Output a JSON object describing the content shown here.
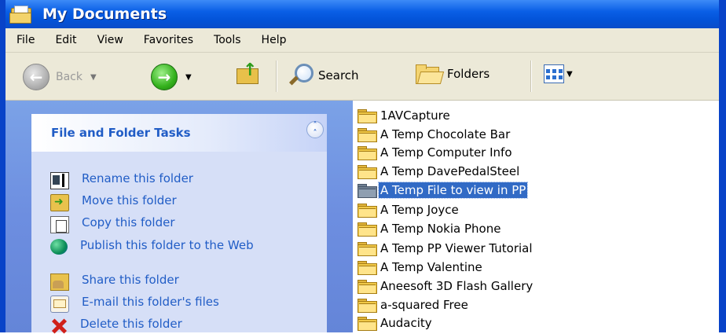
{
  "window": {
    "title": "My Documents"
  },
  "menu": [
    "File",
    "Edit",
    "View",
    "Favorites",
    "Tools",
    "Help"
  ],
  "toolbar": {
    "back_label": "Back",
    "search_label": "Search",
    "folders_label": "Folders"
  },
  "tasks": {
    "title": "File and Folder Tasks",
    "items": [
      "Rename this folder",
      "Move this folder",
      "Copy this folder",
      "Publish this folder to the Web",
      "Share this folder",
      "E-mail this folder's files",
      "Delete this folder"
    ]
  },
  "files": [
    "1AVCapture",
    "A Temp Chocolate Bar",
    "A Temp Computer Info",
    "A Temp DavePedalSteel",
    "A Temp File to view in PP",
    "A Temp Joyce",
    "A Temp Nokia Phone",
    "A Temp PP Viewer Tutorial",
    "A Temp Valentine",
    "Aneesoft 3D Flash Gallery",
    "a-squared Free",
    "Audacity"
  ],
  "selected_file_index": 4,
  "colors": {
    "title_bar": "#0a5fe6",
    "task_link": "#215dc6",
    "selection": "#316ac5"
  }
}
